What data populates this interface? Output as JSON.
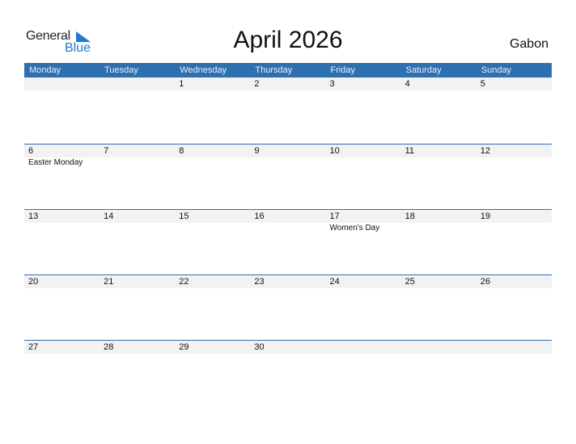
{
  "logo": {
    "word1": "General",
    "word2": "Blue",
    "brand_color": "#1e7bd1"
  },
  "title": "April 2026",
  "country": "Gabon",
  "header_color": "#2e6fb0",
  "weekdays": [
    "Monday",
    "Tuesday",
    "Wednesday",
    "Thursday",
    "Friday",
    "Saturday",
    "Sunday"
  ],
  "weeks": [
    {
      "days": [
        "",
        "",
        "1",
        "2",
        "3",
        "4",
        "5"
      ],
      "events": [
        "",
        "",
        "",
        "",
        "",
        "",
        ""
      ]
    },
    {
      "days": [
        "6",
        "7",
        "8",
        "9",
        "10",
        "11",
        "12"
      ],
      "events": [
        "Easter Monday",
        "",
        "",
        "",
        "",
        "",
        ""
      ]
    },
    {
      "days": [
        "13",
        "14",
        "15",
        "16",
        "17",
        "18",
        "19"
      ],
      "events": [
        "",
        "",
        "",
        "",
        "Women's Day",
        "",
        ""
      ]
    },
    {
      "days": [
        "20",
        "21",
        "22",
        "23",
        "24",
        "25",
        "26"
      ],
      "events": [
        "",
        "",
        "",
        "",
        "",
        "",
        ""
      ]
    },
    {
      "days": [
        "27",
        "28",
        "29",
        "30",
        "",
        "",
        ""
      ],
      "events": [
        "",
        "",
        "",
        "",
        "",
        "",
        ""
      ]
    }
  ]
}
